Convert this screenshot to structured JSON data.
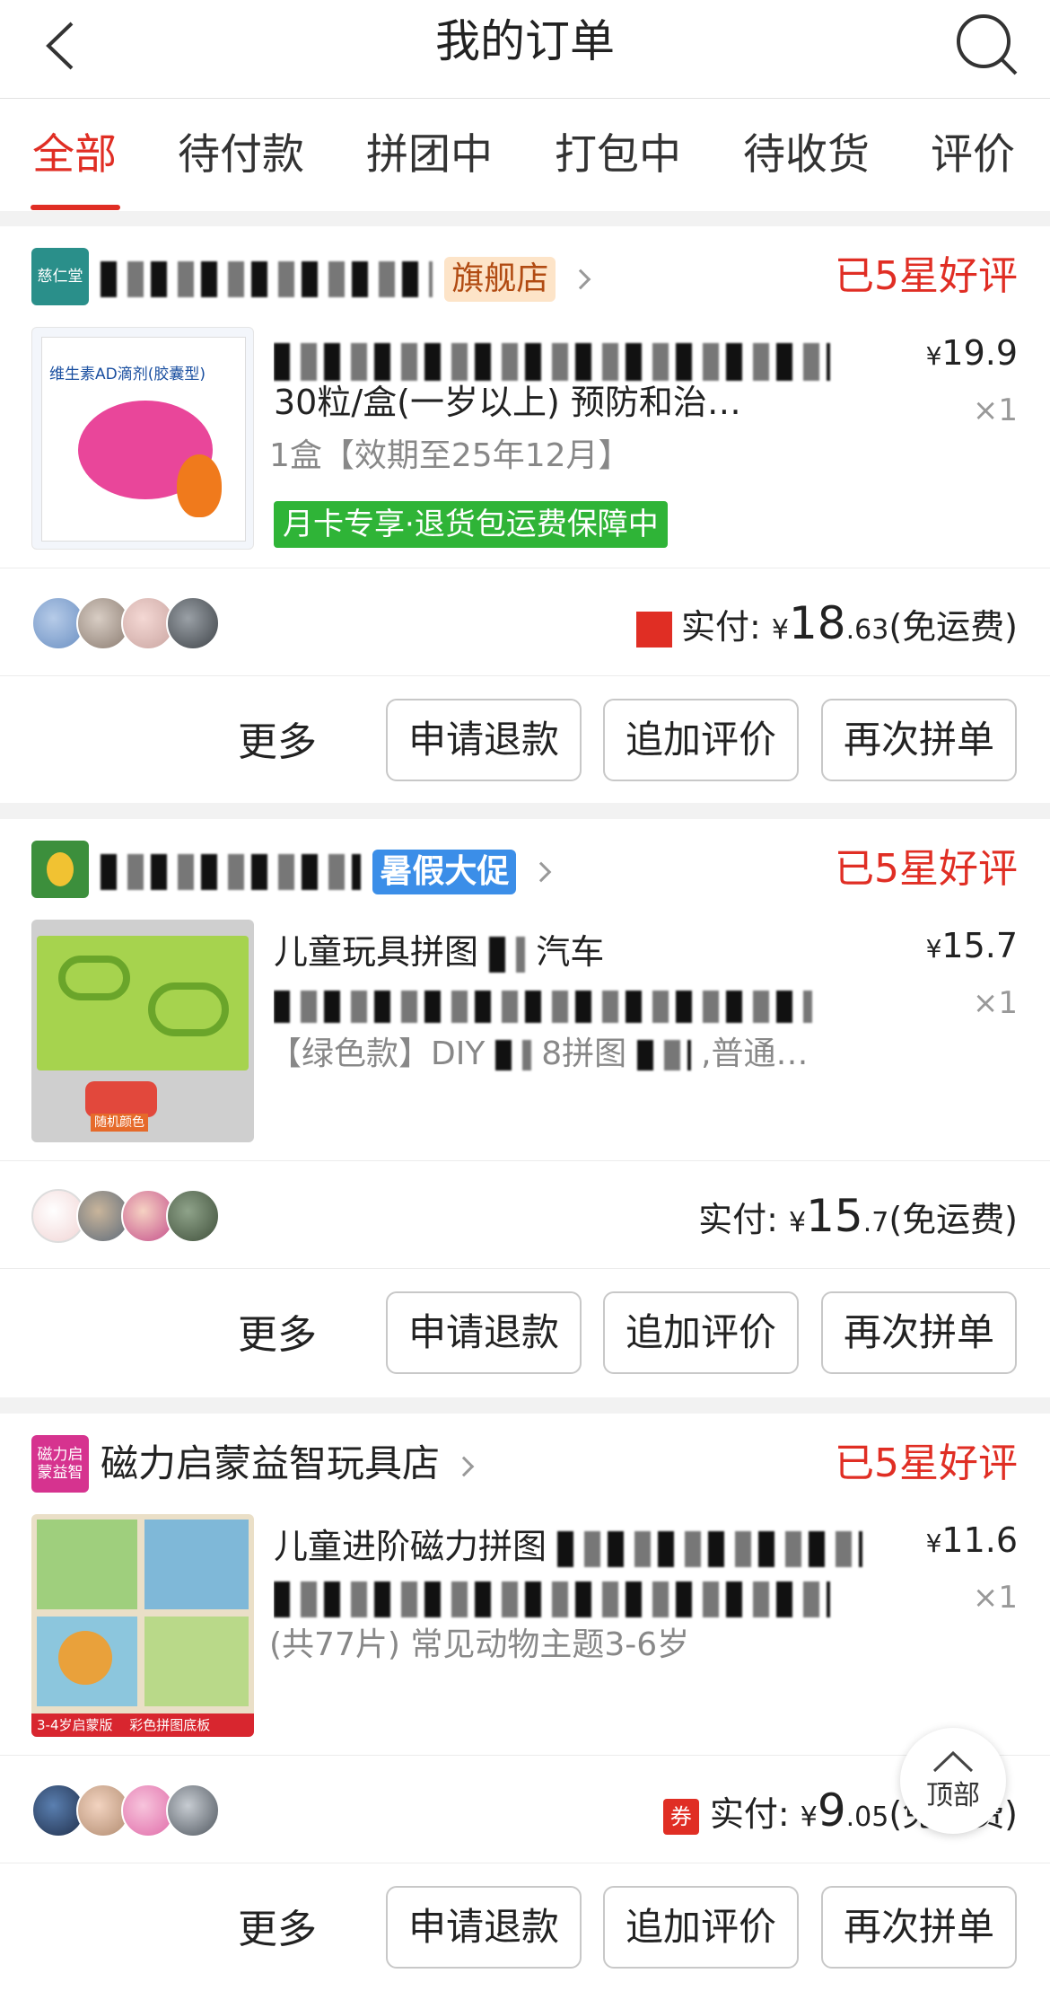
{
  "header": {
    "title": "我的订单"
  },
  "tabs": [
    {
      "label": "全部",
      "active": true
    },
    {
      "label": "待付款",
      "active": false
    },
    {
      "label": "拼团中",
      "active": false
    },
    {
      "label": "打包中",
      "active": false
    },
    {
      "label": "待收货",
      "active": false
    },
    {
      "label": "评价",
      "active": false
    }
  ],
  "orders": [
    {
      "shop": {
        "logo_text": "慈仁堂",
        "badge": "旗舰店"
      },
      "status": "已5星好评",
      "product": {
        "name": "30粒/盒(一岁以上) 预防和治…",
        "spec": "1盒【效期至25年12月】",
        "tag": "月卡专享·退货包运费保障中",
        "price_symbol": "¥",
        "price": "19.9",
        "qty": "×1",
        "thumb_text": "维生素AD滴剂(胶囊型)"
      },
      "paid": {
        "label": "实付:",
        "symbol": "¥",
        "amount_int": "18",
        "amount_dec": ".63",
        "note": "(免运费)"
      },
      "actions": {
        "more": "更多",
        "refund": "申请退款",
        "review": "追加评价",
        "rebuy": "再次拼单"
      }
    },
    {
      "shop": {
        "logo_text": "",
        "badge": "暑假大促"
      },
      "status": "已5星好评",
      "product": {
        "name": "儿童玩具拼图",
        "name_suffix": "汽车",
        "spec": "【绿色款】DIY",
        "spec_suffix": "8拼图",
        "spec_tail": ",普通…",
        "price_symbol": "¥",
        "price": "15.7",
        "qty": "×1",
        "thumb_text": "随机颜色"
      },
      "paid": {
        "label": "实付:",
        "symbol": "¥",
        "amount_int": "15",
        "amount_dec": ".7",
        "note": "(免运费)"
      },
      "actions": {
        "more": "更多",
        "refund": "申请退款",
        "review": "追加评价",
        "rebuy": "再次拼单"
      }
    },
    {
      "shop": {
        "logo_text": "磁力启蒙益智",
        "name": "磁力启蒙益智玩具店"
      },
      "status": "已5星好评",
      "product": {
        "name": "儿童进阶磁力拼图",
        "spec": "(共77片) 常见动物主题3-6岁",
        "price_symbol": "¥",
        "price": "11.6",
        "qty": "×1",
        "thumb_text": "3-4岁启蒙版",
        "thumb_text2": "彩色拼图底板"
      },
      "paid": {
        "coupon": "券",
        "label": "实付:",
        "symbol": "¥",
        "amount_int": "9",
        "amount_dec": ".05",
        "note": "(免运费)"
      },
      "actions": {
        "more": "更多",
        "refund": "申请退款",
        "review": "追加评价",
        "rebuy": "再次拼单"
      }
    }
  ],
  "to_top": {
    "label": "顶部"
  },
  "colors": {
    "accent": "#e02e24",
    "green_tag": "#2fb437",
    "promo_blue": "#3b8ee8"
  }
}
